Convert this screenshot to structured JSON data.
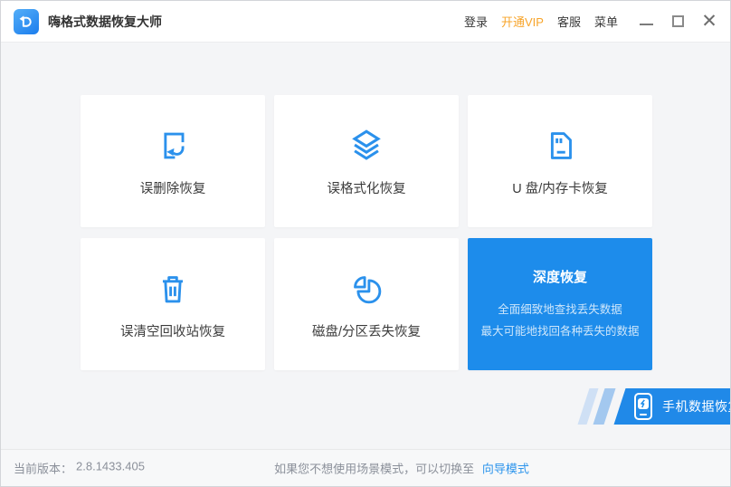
{
  "window": {
    "title": "嗨格式数据恢复大师"
  },
  "titlebar": {
    "login_label": "登录",
    "vip_label": "开通VIP",
    "support_label": "客服",
    "menu_label": "菜单"
  },
  "cards": [
    {
      "label": "误删除恢复",
      "icon": "restore-file-icon"
    },
    {
      "label": "误格式化恢复",
      "icon": "layers-icon"
    },
    {
      "label": "U 盘/内存卡恢复",
      "icon": "sd-card-icon"
    },
    {
      "label": "误清空回收站恢复",
      "icon": "trash-icon"
    },
    {
      "label": "磁盘/分区丢失恢复",
      "icon": "pie-chart-icon"
    },
    {
      "label": "深度恢复",
      "subtitle1": "全面细致地查找丢失数据",
      "subtitle2": "最大可能地找回各种丢失的数据",
      "highlighted": true
    }
  ],
  "phone_cta": {
    "label": "手机数据恢复",
    "icon": "phone-recovery-icon"
  },
  "footer": {
    "version_label": "当前版本：",
    "version": "2.8.1433.405",
    "hint": "如果您不想使用场景模式，可以切换至",
    "link_label": "向导模式"
  },
  "colors": {
    "accent_blue": "#2b91ec",
    "deep_card_blue": "#1d8ceb",
    "cta_blue": "#2089e8",
    "vip_orange": "#f7a42a",
    "main_bg": "#f4f5f7",
    "footer_text": "#8b909a",
    "link_blue": "#2e95ec"
  }
}
